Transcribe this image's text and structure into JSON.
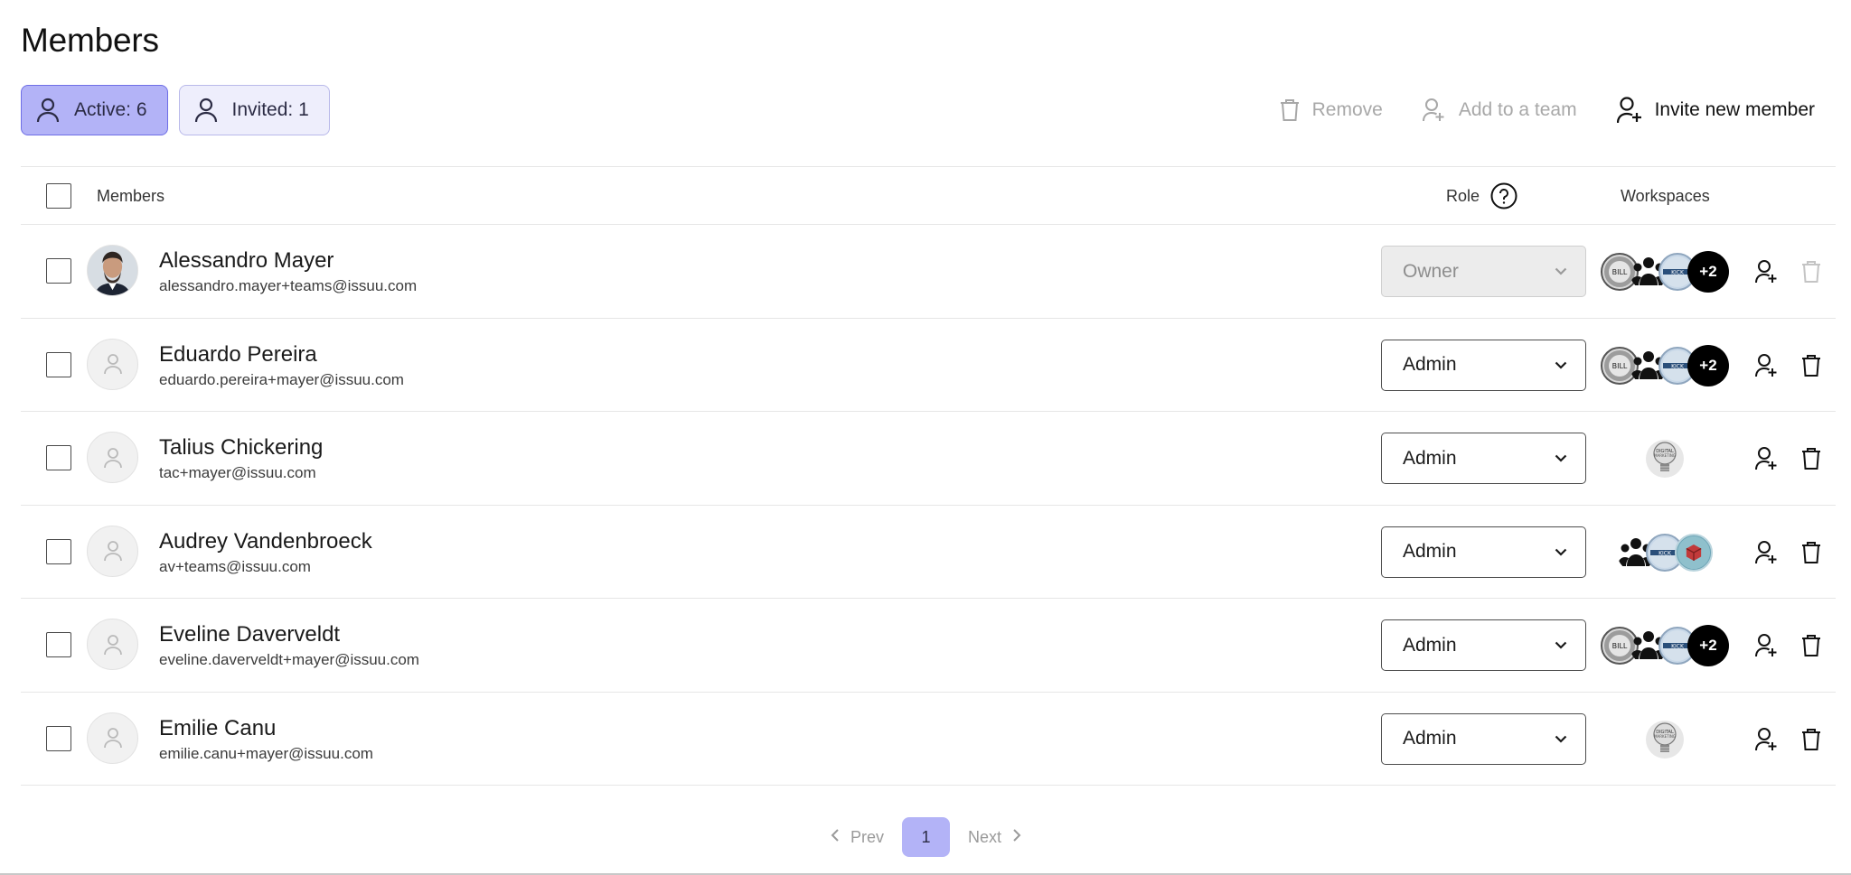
{
  "page": {
    "title": "Members"
  },
  "filters": {
    "active": {
      "label": "Active: 6"
    },
    "invited": {
      "label": "Invited: 1"
    }
  },
  "toolbar": {
    "remove": "Remove",
    "add_to_team": "Add to a team",
    "invite": "Invite new member"
  },
  "table": {
    "headers": {
      "members": "Members",
      "role": "Role",
      "workspaces": "Workspaces"
    },
    "rows": [
      {
        "name": "Alessandro Mayer",
        "email": "alessandro.mayer+teams@issuu.com",
        "role": "Owner",
        "role_disabled": true,
        "avatar": "photo",
        "workspaces": [
          "billing",
          "people",
          "badge",
          "+2"
        ],
        "delete_disabled": true
      },
      {
        "name": "Eduardo Pereira",
        "email": "eduardo.pereira+mayer@issuu.com",
        "role": "Admin",
        "role_disabled": false,
        "avatar": "placeholder",
        "workspaces": [
          "billing",
          "people",
          "badge",
          "+2"
        ],
        "delete_disabled": false
      },
      {
        "name": "Talius Chickering",
        "email": "tac+mayer@issuu.com",
        "role": "Admin",
        "role_disabled": false,
        "avatar": "placeholder",
        "workspaces": [
          "bulb"
        ],
        "delete_disabled": false
      },
      {
        "name": "Audrey Vandenbroeck",
        "email": "av+teams@issuu.com",
        "role": "Admin",
        "role_disabled": false,
        "avatar": "placeholder",
        "workspaces": [
          "people",
          "badge",
          "photo3d"
        ],
        "delete_disabled": false
      },
      {
        "name": "Eveline Daverveldt",
        "email": "eveline.daverveldt+mayer@issuu.com",
        "role": "Admin",
        "role_disabled": false,
        "avatar": "placeholder",
        "workspaces": [
          "billing",
          "people",
          "badge",
          "+2"
        ],
        "delete_disabled": false
      },
      {
        "name": "Emilie Canu",
        "email": "emilie.canu+mayer@issuu.com",
        "role": "Admin",
        "role_disabled": false,
        "avatar": "placeholder",
        "workspaces": [
          "bulb"
        ],
        "delete_disabled": false
      }
    ]
  },
  "pagination": {
    "prev": "Prev",
    "current": "1",
    "next": "Next"
  },
  "colors": {
    "accent": "#b3b3f7",
    "accent_border": "#6e6ee6",
    "disabled": "#a8a8a8"
  }
}
